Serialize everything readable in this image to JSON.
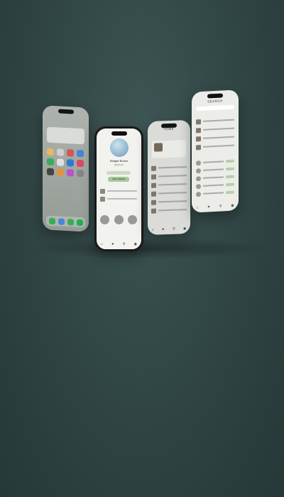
{
  "profile": {
    "name": "Bridget Brown",
    "handle": "@bbrown",
    "status_pill": "",
    "add_friend": "ADD FRIEND"
  },
  "home": {
    "title": "HOME"
  },
  "search": {
    "title": "SEARCH",
    "placeholder": "",
    "section_songs": "",
    "section_users": ""
  },
  "colors": {
    "background": "#2f4443",
    "accent_green": "#a8c79b",
    "phone_frame": "#1a1a1a"
  },
  "tabbar_icons": [
    "home-icon",
    "send-icon",
    "search-icon",
    "profile-icon"
  ]
}
